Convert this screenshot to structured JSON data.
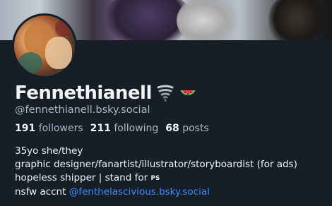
{
  "profile": {
    "display_name": "Fennethianell",
    "name_emojis": [
      "tornado-emoji",
      "watermelon-emoji"
    ],
    "handle": "@fennethianell.bsky.social",
    "stats": {
      "followers_count": "191",
      "followers_label": "followers",
      "following_count": "211",
      "following_label": "following",
      "posts_count": "68",
      "posts_label": "posts"
    },
    "bio": {
      "line1": "35yo she/they",
      "line2": "graphic designer/fanartist/illustrator/storyboardist (for ads)",
      "line3_text": "hopeless shipper | stand for ",
      "line3_mark": "PS",
      "line4_text": "nsfw accnt ",
      "line4_link": "@fenthelascivious.bsky.social"
    }
  },
  "colors": {
    "background": "#161e27",
    "text_primary": "#f1f3f5",
    "text_secondary": "#aeb8c3",
    "link": "#3b8aff"
  }
}
